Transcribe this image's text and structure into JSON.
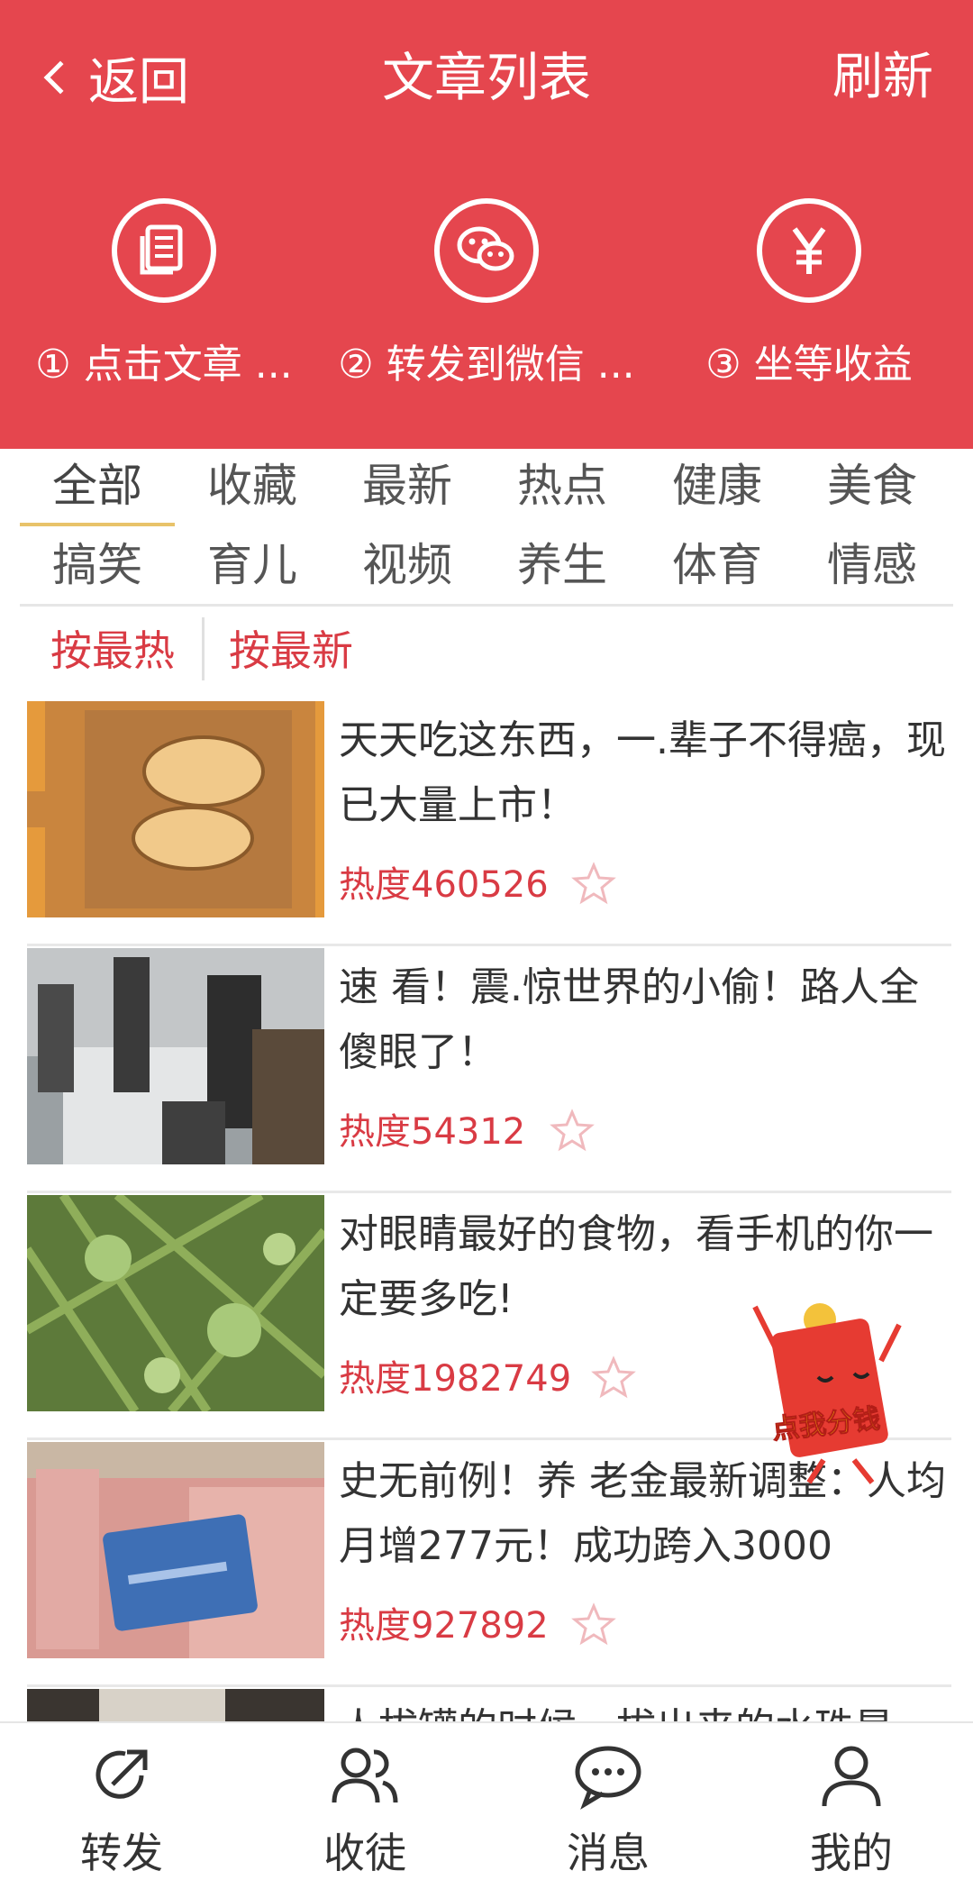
{
  "header": {
    "back_label": "返回",
    "title": "文章列表",
    "refresh_label": "刷新"
  },
  "steps": [
    {
      "label": "① 点击文章 ...",
      "icon": "document-icon"
    },
    {
      "label": "② 转发到微信 ...",
      "icon": "wechat-icon"
    },
    {
      "label": "③ 坐等收益",
      "icon": "yuan-icon"
    }
  ],
  "tabs": [
    "全部",
    "收藏",
    "最新",
    "热点",
    "健康",
    "美食",
    "搞笑",
    "育儿",
    "视频",
    "养生",
    "体育",
    "情感"
  ],
  "sort": {
    "hot_label": "按最热",
    "new_label": "按最新"
  },
  "articles": [
    {
      "title": "天天吃这东西，一.辈子不得癌，现已大量上市！",
      "heat": "热度460526"
    },
    {
      "title": "速 看！震.惊世界的小偷！路人全傻眼了！",
      "heat": "热度54312"
    },
    {
      "title": "对眼睛最好的食物，看手机的你一定要多吃!",
      "heat": "热度1982749"
    },
    {
      "title": "史无前例！养 老金最新调整：人均月增277元！成功跨入3000",
      "heat": "热度927892"
    },
    {
      "title": "人拔罐的时候，拔出来的水珠是",
      "heat": ""
    }
  ],
  "red_packet_label": "点我分钱",
  "bottom_nav": [
    {
      "label": "转发",
      "icon": "share-icon"
    },
    {
      "label": "收徒",
      "icon": "users-icon"
    },
    {
      "label": "消息",
      "icon": "message-icon"
    },
    {
      "label": "我的",
      "icon": "profile-icon"
    }
  ],
  "colors": {
    "primary_red": "#e5464e",
    "accent_red": "#d93b44",
    "tab_underline": "#e8c36a"
  }
}
